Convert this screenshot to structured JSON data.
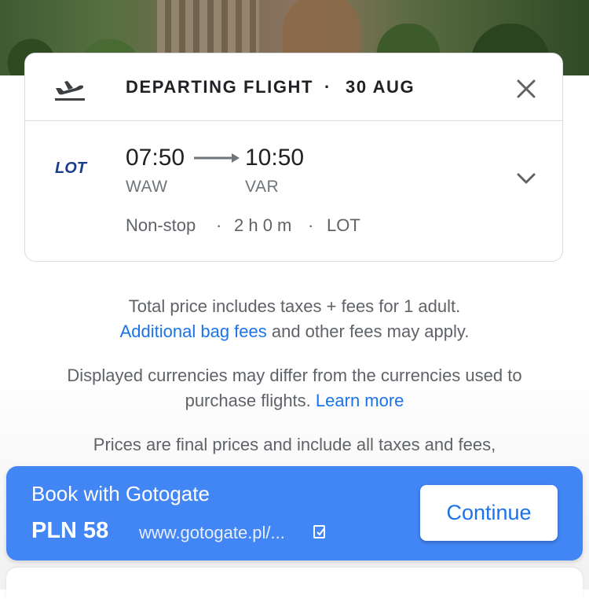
{
  "flight_card": {
    "title": "DEPARTING FLIGHT",
    "separator": "·",
    "date": "30 AUG",
    "airline_logo_text": "LOT",
    "departure_time": "07:50",
    "arrival_time": "10:50",
    "departure_airport": "WAW",
    "arrival_airport": "VAR",
    "stops": "Non-stop",
    "duration": "2 h 0 m",
    "airline": "LOT",
    "icons": [
      "flight-takeoff-icon",
      "close-icon",
      "chevron-down-icon"
    ]
  },
  "notes": {
    "price_line": "Total price includes taxes + fees for 1 adult.",
    "bag_fees_link": "Additional bag fees",
    "bag_fees_rest": " and other fees may apply.",
    "currency_line": "Displayed currencies may differ from the currencies used to purchase flights.",
    "learn_more_link": "Learn more",
    "final_prices_line": "Prices are final prices and include all taxes and fees,"
  },
  "booking_bar": {
    "title": "Book with Gotogate",
    "price": "PLN 58",
    "url": "www.gotogate.pl/...",
    "continue_label": "Continue",
    "color": "#4285f4"
  },
  "colors": {
    "link": "#1a73e8",
    "text_primary": "#202124",
    "text_secondary": "#5f6368"
  }
}
